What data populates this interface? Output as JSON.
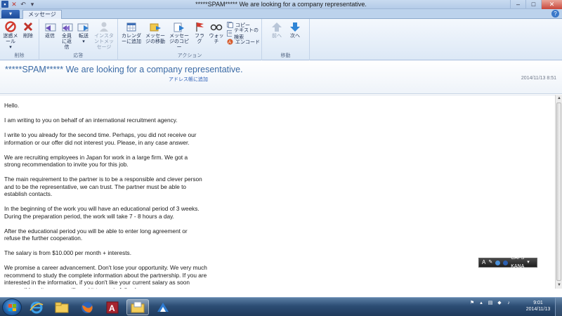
{
  "window": {
    "title": "*****SPAM***** We are looking for a company representative.",
    "qat_save": "save-icon",
    "qat_delete": "delete-icon",
    "qat_undo": "undo-icon"
  },
  "tabs": {
    "file_tab": "▾",
    "message_tab": "メッセージ"
  },
  "ribbon": {
    "groups": {
      "delete": "削除",
      "respond": "応答",
      "actions": "アクション",
      "move": "移動"
    },
    "buttons": {
      "junk": "迷惑メール",
      "junk_arrow": "▾",
      "delete": "削除",
      "reply": "返信",
      "reply_all": "全員に返信",
      "forward": "転送",
      "forward_arrow": "▾",
      "im": "インスタントメッセージ",
      "add_to_calendar": "カレンダーに追加",
      "move_message": "メッセージの移動",
      "copy_message": "メッセージのコピー",
      "flag": "フラグ",
      "watch": "ウォッチ",
      "copy": "コピー",
      "find_text": "テキストの検索",
      "encoding": "エンコード",
      "previous": "前へ",
      "next": "次へ"
    }
  },
  "message": {
    "subject": "*****SPAM***** We are looking for a company representative.",
    "add_to_contacts": "アドレス帳に追加",
    "date": "2014/11/13 8:51",
    "body": [
      "Hello.",
      "I am writing to you on behalf of an international recruitment agency.",
      "I write to you already for the second time. Perhaps, you did not receive our\ninformation or our offer did not interest you. Please, in any case answer.",
      "We are recruiting employees in Japan for work in a large firm. We got a\nstrong recommendation to invite you for this job.",
      "The main requirement to the partner is to be a responsible and clever person\nand to be the representative, we can trust. The partner must be able to\nestablish contacts.",
      "In the beginning of the work you will have an educational period of 3 weeks.\nDuring the preparation period, the work will take 7 - 8 hours a day.",
      "After the educational period you will be able to enter long agreement or\nrefuse the further cooperation.",
      "The salary is from $10.000 per month + interests.",
      "We promise a career advancement. Don't lose your opportunity. We very much\nrecommend to study the complete information about the partnership. If you are\ninterested in the information, if you don't like your current salary as soon\nas possible write us, we will send it to you in full volume."
    ]
  },
  "language_bar": {
    "ime": "A",
    "mode_top": "CAPS",
    "mode_bottom": "KANA"
  },
  "taskbar": {
    "apps": [
      "internet-explorer-icon",
      "file-explorer-icon",
      "firefox-icon",
      "access-icon",
      "windows-mail-icon",
      "network-app-icon"
    ],
    "time": "9:01",
    "date": "2014/11/13"
  },
  "colors": {
    "subject": "#3a6aa5",
    "link": "#2c5fb8",
    "close_button": "#c8463a",
    "taskbar": "#2c4d74"
  }
}
